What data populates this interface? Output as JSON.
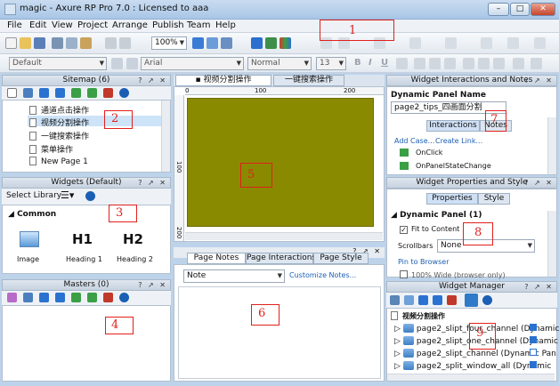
{
  "window": {
    "title": "magic - Axure RP Pro 7.0 : Licensed to aaa",
    "min": "–",
    "max": "□",
    "close": "✕"
  },
  "menu": [
    "File",
    "Edit",
    "View",
    "Project",
    "Arrange",
    "Publish",
    "Team",
    "Help"
  ],
  "toolbar": {
    "zoom": "100%",
    "style": "Default",
    "font": "Arial",
    "weight": "Normal",
    "size": "13"
  },
  "sitemap": {
    "title": "Sitemap (6)",
    "pages": [
      "通道点击操作",
      "视频分割操作",
      "一键搜索操作",
      "菜单操作",
      "New Page 1"
    ]
  },
  "widgets": {
    "title": "Widgets (Default)",
    "select_library": "Select Library",
    "section": "Common",
    "items": [
      {
        "glyph": "",
        "label": "Image"
      },
      {
        "glyph": "H1",
        "label": "Heading 1"
      },
      {
        "glyph": "H2",
        "label": "Heading 2"
      }
    ]
  },
  "masters": {
    "title": "Masters (0)"
  },
  "canvas": {
    "tabs": [
      "视频分割操作",
      "一键搜索操作"
    ],
    "ruler_h": [
      "0",
      "100",
      "200"
    ],
    "ruler_v": [
      "100",
      "200"
    ],
    "panel_color": "#8a8a00"
  },
  "page_notes": {
    "tabs": [
      "Page Notes",
      "Page Interactions",
      "Page Style"
    ],
    "note_select": "Note",
    "customize": "Customize Notes..."
  },
  "interactions": {
    "title": "Widget Interactions and Notes",
    "name_label": "Dynamic Panel Name",
    "name_value": "page2_tips_四画面分割",
    "tabs": [
      "Interactions",
      "Notes"
    ],
    "add_case": "Add Case...",
    "create_link": "Create Link...",
    "events": [
      "OnClick",
      "OnPanelStateChange"
    ]
  },
  "properties": {
    "title": "Widget Properties and Style",
    "tabs": [
      "Properties",
      "Style"
    ],
    "panel": "Dynamic Panel (1)",
    "fit_label": "Fit to Content",
    "scrollbars_label": "Scrollbars",
    "scrollbars_value": "None",
    "pin": "Pin to Browser",
    "wide": "100% Wide (browser only)"
  },
  "manager": {
    "title": "Widget Manager",
    "root": "视频分割操作",
    "items": [
      "page2_slipt_four_channel (Dynamic",
      "page2_slipt_one_channel (Dynamic",
      "page2_slipt_channel (Dynamic Pan",
      "page2_split_window_all (Dynamic"
    ]
  },
  "annotations": [
    "1",
    "2",
    "3",
    "4",
    "5",
    "6",
    "7",
    "8",
    "9"
  ]
}
